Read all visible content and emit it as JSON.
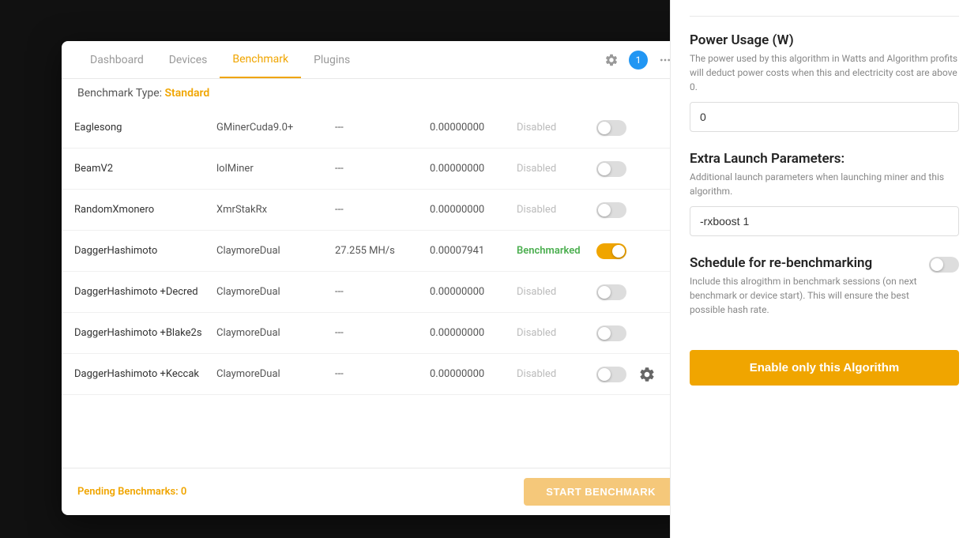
{
  "nav": {
    "items": [
      {
        "label": "Dashboard",
        "active": false
      },
      {
        "label": "Devices",
        "active": false
      },
      {
        "label": "Benchmark",
        "active": true
      },
      {
        "label": "Plugins",
        "active": false
      }
    ],
    "badge_count": "1"
  },
  "benchmark": {
    "type_label": "Benchmark Type:",
    "type_value": "Standard"
  },
  "algorithms": [
    {
      "name": "Eaglesong",
      "miner": "GMinerCuda9.0+",
      "speed": "---",
      "profit": "0.00000000",
      "status": "Disabled",
      "toggle": "off",
      "gear": false
    },
    {
      "name": "BeamV2",
      "miner": "lolMiner",
      "speed": "---",
      "profit": "0.00000000",
      "status": "Disabled",
      "toggle": "off",
      "gear": false
    },
    {
      "name": "RandomXmonero",
      "miner": "XmrStakRx",
      "speed": "---",
      "profit": "0.00000000",
      "status": "Disabled",
      "toggle": "off",
      "gear": false
    },
    {
      "name": "DaggerHashimoto",
      "miner": "ClaymoreDual",
      "speed": "27.255 MH/s",
      "profit": "0.00007941",
      "status": "Benchmarked",
      "toggle": "on",
      "gear": false
    },
    {
      "name": "DaggerHashimoto +Decred",
      "miner": "ClaymoreDual",
      "speed": "---",
      "profit": "0.00000000",
      "status": "Disabled",
      "toggle": "off",
      "gear": false
    },
    {
      "name": "DaggerHashimoto +Blake2s",
      "miner": "ClaymoreDual",
      "speed": "---",
      "profit": "0.00000000",
      "status": "Disabled",
      "toggle": "off",
      "gear": false
    },
    {
      "name": "DaggerHashimoto +Keccak",
      "miner": "ClaymoreDual",
      "speed": "---",
      "profit": "0.00000000",
      "status": "Disabled",
      "toggle": "off",
      "gear": true
    }
  ],
  "footer": {
    "pending_label": "Pending Benchmarks: 0",
    "start_button": "START BENCHMARK"
  },
  "right_panel": {
    "power_usage": {
      "title": "Power Usage (W)",
      "description": "The power used by this algorithm in Watts and Algorithm profits will deduct power costs when this and electricity cost are above 0.",
      "value": "0"
    },
    "extra_params": {
      "title": "Extra Launch Parameters:",
      "description": "Additional launch parameters when launching miner and this algorithm.",
      "value": "-rxboost 1"
    },
    "rebenchmark": {
      "title": "Schedule for re-benchmarking",
      "description": "Include this alrogithm in benchmark sessions (on next benchmark or device start). This will ensure the best possible hash rate.",
      "toggle": "off"
    },
    "enable_button": "Enable only this Algorithm"
  }
}
